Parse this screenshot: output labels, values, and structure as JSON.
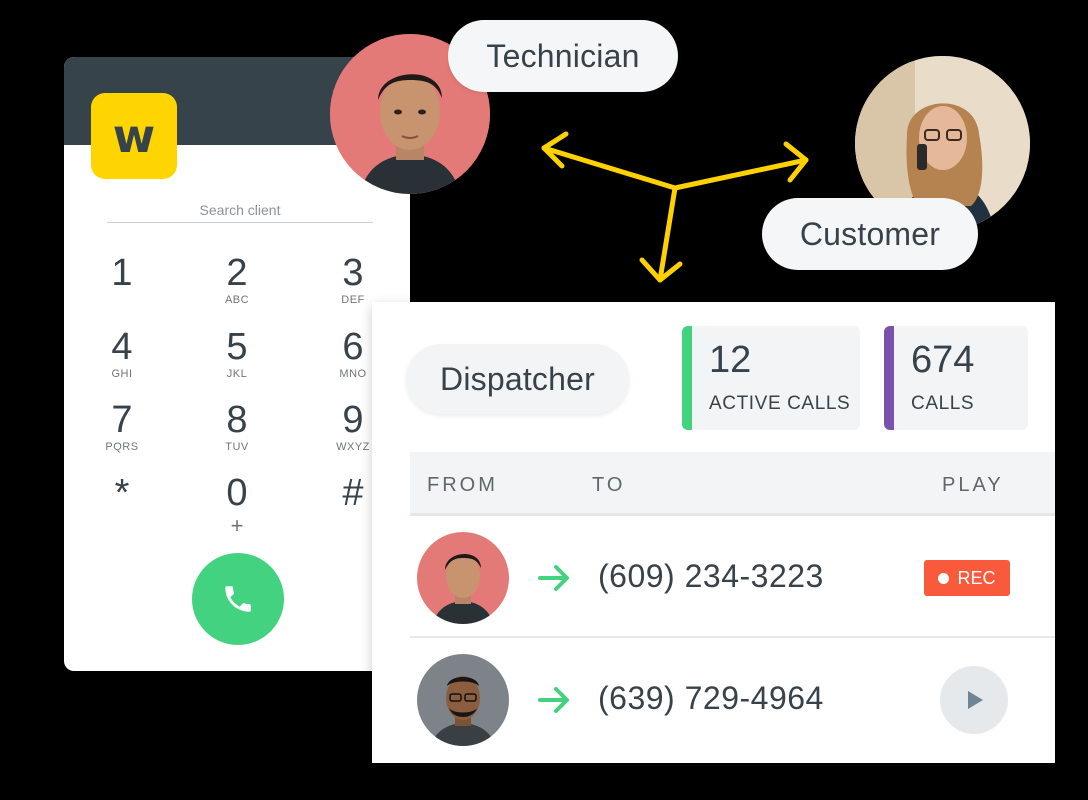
{
  "dialer": {
    "logo_letter": "w",
    "search_placeholder": "Search client",
    "keys": [
      {
        "digit": "1",
        "letters": ""
      },
      {
        "digit": "2",
        "letters": "ABC"
      },
      {
        "digit": "3",
        "letters": "DEF"
      },
      {
        "digit": "4",
        "letters": "GHI"
      },
      {
        "digit": "5",
        "letters": "JKL"
      },
      {
        "digit": "6",
        "letters": "MNO"
      },
      {
        "digit": "7",
        "letters": "PQRS"
      },
      {
        "digit": "8",
        "letters": "TUV"
      },
      {
        "digit": "9",
        "letters": "WXYZ"
      },
      {
        "digit": "*",
        "letters": ""
      },
      {
        "digit": "0",
        "letters": "+"
      },
      {
        "digit": "#",
        "letters": ""
      }
    ],
    "call_icon": "phone-icon"
  },
  "roles": {
    "technician": "Technician",
    "customer": "Customer",
    "dispatcher": "Dispatcher"
  },
  "stats": {
    "active_calls": {
      "value": "12",
      "label": "ACTIVE CALLS",
      "color": "#43d27f"
    },
    "calls": {
      "value": "674",
      "label": "CALLS",
      "color": "#7b52ab"
    }
  },
  "table": {
    "headers": {
      "from": "FROM",
      "to": "TO",
      "play": "PLAY"
    },
    "rows": [
      {
        "to": "(609) 234-3223",
        "action": "REC"
      },
      {
        "to": "(639) 729-4964",
        "action": "play"
      }
    ]
  },
  "colors": {
    "brand_yellow": "#ffd500",
    "dark_header": "#37434a",
    "call_green": "#43d27f",
    "rec_red": "#fa5a3c",
    "arrow_yellow": "#ffd100"
  }
}
